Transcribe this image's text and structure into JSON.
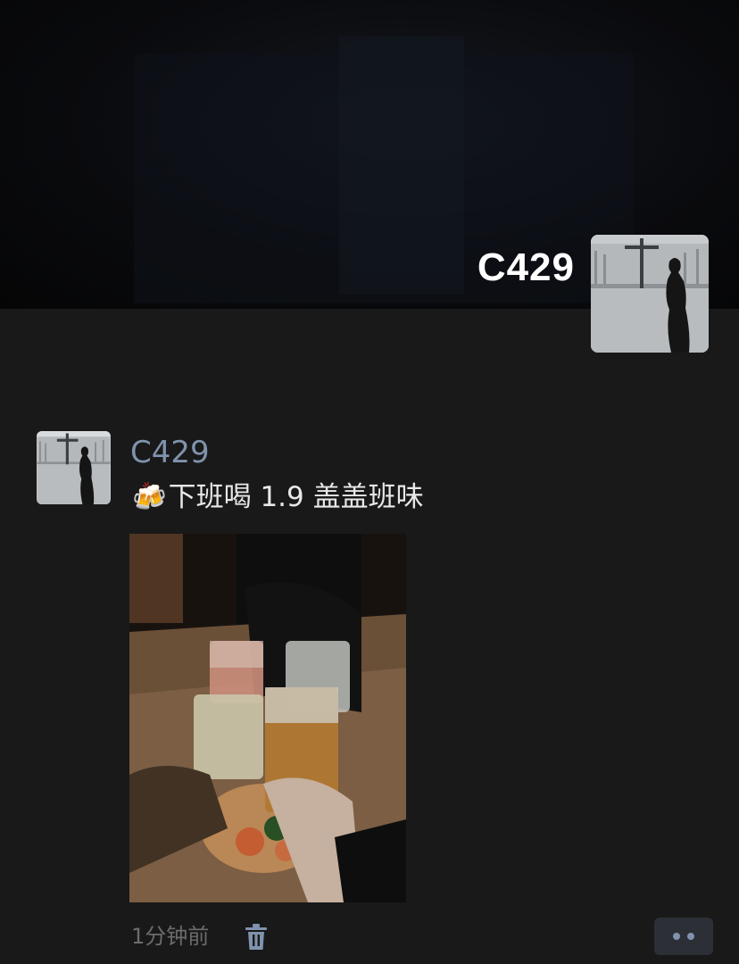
{
  "profile": {
    "cover_name": "C429",
    "avatar_icon": "silhouette-cross-avatar"
  },
  "post": {
    "author": "C429",
    "emoji": "🍻",
    "text": "下班喝 1.9 盖盖班味",
    "photo_icon": "drinks-toast-photo",
    "time": "1分钟前"
  },
  "actions": {
    "delete_icon": "trash-icon",
    "more_icon": "more-dots-icon"
  },
  "colors": {
    "background": "#191919",
    "name_link": "#7f93ad",
    "text": "#e8e8e8",
    "muted": "#6c6c6c",
    "more_button_bg": "#2d2f36"
  }
}
